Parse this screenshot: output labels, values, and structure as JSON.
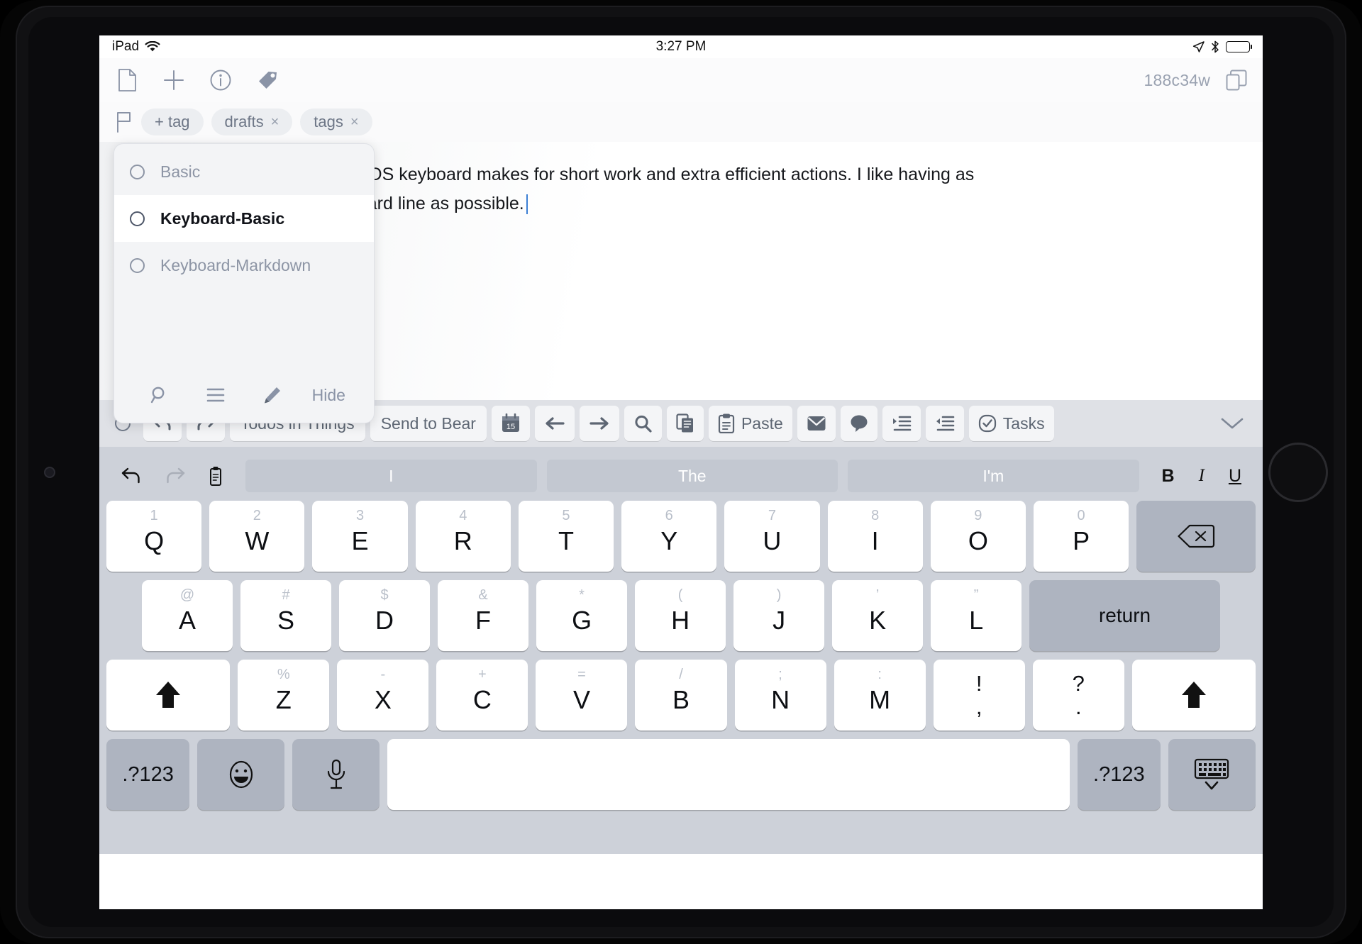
{
  "status_bar": {
    "device": "iPad",
    "wifi_icon": "wifi-icon",
    "time": "3:27 PM",
    "location_icon": "location-arrow-icon",
    "bluetooth_icon": "bluetooth-icon",
    "battery_icon": "battery-full-icon"
  },
  "app_bar": {
    "icons": [
      {
        "name": "new-document-icon",
        "label": "New Document"
      },
      {
        "name": "add-icon",
        "label": "Add"
      },
      {
        "name": "info-icon",
        "label": "Info"
      },
      {
        "name": "tag-icon",
        "label": "Tag"
      }
    ],
    "doc_id": "188c34w",
    "duplicate_icon": "duplicate-window-icon"
  },
  "tag_bar": {
    "flag_icon": "flag-icon",
    "add_tag_label": "+ tag",
    "tags": [
      {
        "label": "drafts",
        "remove": "×"
      },
      {
        "label": "tags",
        "remove": "×"
      }
    ]
  },
  "editor": {
    "body_text": "bove the regular iOS keyboard makes for short work and extra efficient actions. I like having as ions in this keyboard line as possible.",
    "line1": "bove the regular iOS keyboard makes for short work and extra efficient actions. I like having as",
    "line2": "ions in this keyboard line as possible."
  },
  "popup": {
    "options": [
      {
        "label": "Basic",
        "selected": false
      },
      {
        "label": "Keyboard-Basic",
        "selected": true
      },
      {
        "label": "Keyboard-Markdown",
        "selected": false
      }
    ],
    "footer": {
      "search_icon": "search-icon",
      "list_icon": "list-menu-icon",
      "edit_icon": "pencil-edit-icon",
      "hide_label": "Hide"
    }
  },
  "action_row": {
    "status_circle": "record-circle-icon",
    "items": [
      {
        "name": "undo-button",
        "icon": "undo-icon",
        "label": ""
      },
      {
        "name": "redo-button",
        "icon": "redo-icon",
        "label": ""
      },
      {
        "name": "todos-in-things-button",
        "icon": "",
        "label": "Todos in Things"
      },
      {
        "name": "send-to-bear-button",
        "icon": "",
        "label": "Send to Bear"
      },
      {
        "name": "calendar-button",
        "icon": "calendar-icon",
        "label": "",
        "badge": "15"
      },
      {
        "name": "move-left-button",
        "icon": "arrow-left-icon",
        "label": ""
      },
      {
        "name": "move-right-button",
        "icon": "arrow-right-icon",
        "label": ""
      },
      {
        "name": "search-button",
        "icon": "search-icon",
        "label": ""
      },
      {
        "name": "copy-button",
        "icon": "copy-icon",
        "label": ""
      },
      {
        "name": "paste-button",
        "icon": "clipboard-icon",
        "label": "Paste"
      },
      {
        "name": "mail-button",
        "icon": "mail-icon",
        "label": ""
      },
      {
        "name": "message-button",
        "icon": "message-bubble-icon",
        "label": ""
      },
      {
        "name": "indent-button",
        "icon": "indent-increase-icon",
        "label": ""
      },
      {
        "name": "outdent-button",
        "icon": "indent-decrease-icon",
        "label": ""
      },
      {
        "name": "tasks-button",
        "icon": "checkmark-circle-icon",
        "label": "Tasks"
      }
    ],
    "collapse_icon": "chevron-down-icon"
  },
  "keyboard": {
    "predictive": {
      "tools": [
        {
          "name": "keyboard-undo-icon"
        },
        {
          "name": "keyboard-redo-icon"
        },
        {
          "name": "keyboard-paste-icon"
        }
      ],
      "suggestions": [
        "I",
        "The",
        "I'm"
      ],
      "format": [
        {
          "name": "bold-button",
          "label": "B"
        },
        {
          "name": "italic-button",
          "label": "I"
        },
        {
          "name": "underline-button",
          "label": "U"
        }
      ]
    },
    "row1": [
      {
        "main": "Q",
        "sub": "1"
      },
      {
        "main": "W",
        "sub": "2"
      },
      {
        "main": "E",
        "sub": "3"
      },
      {
        "main": "R",
        "sub": "4"
      },
      {
        "main": "T",
        "sub": "5"
      },
      {
        "main": "Y",
        "sub": "6"
      },
      {
        "main": "U",
        "sub": "7"
      },
      {
        "main": "I",
        "sub": "8"
      },
      {
        "main": "O",
        "sub": "9"
      },
      {
        "main": "P",
        "sub": "0"
      }
    ],
    "row1_backspace": "delete-left-icon",
    "row2": [
      {
        "main": "A",
        "sub": "@"
      },
      {
        "main": "S",
        "sub": "#"
      },
      {
        "main": "D",
        "sub": "$"
      },
      {
        "main": "F",
        "sub": "&"
      },
      {
        "main": "G",
        "sub": "*"
      },
      {
        "main": "H",
        "sub": "("
      },
      {
        "main": "J",
        "sub": ")"
      },
      {
        "main": "K",
        "sub": "’"
      },
      {
        "main": "L",
        "sub": "”"
      }
    ],
    "row2_return": "return",
    "row3": [
      {
        "main": "Z",
        "sub": "%"
      },
      {
        "main": "X",
        "sub": "-"
      },
      {
        "main": "C",
        "sub": "+"
      },
      {
        "main": "V",
        "sub": "="
      },
      {
        "main": "B",
        "sub": "/"
      },
      {
        "main": "N",
        "sub": ";"
      },
      {
        "main": "M",
        "sub": ":"
      }
    ],
    "row3_punct": [
      {
        "top": "!",
        "bot": ","
      },
      {
        "top": "?",
        "bot": "."
      }
    ],
    "shift_icon": "shift-arrow-icon",
    "row4": {
      "numeric_left": ".?123",
      "emoji_icon": "emoji-smiley-icon",
      "mic_icon": "microphone-icon",
      "space": "",
      "numeric_right": ".?123",
      "dismiss_icon": "keyboard-dismiss-icon"
    }
  }
}
